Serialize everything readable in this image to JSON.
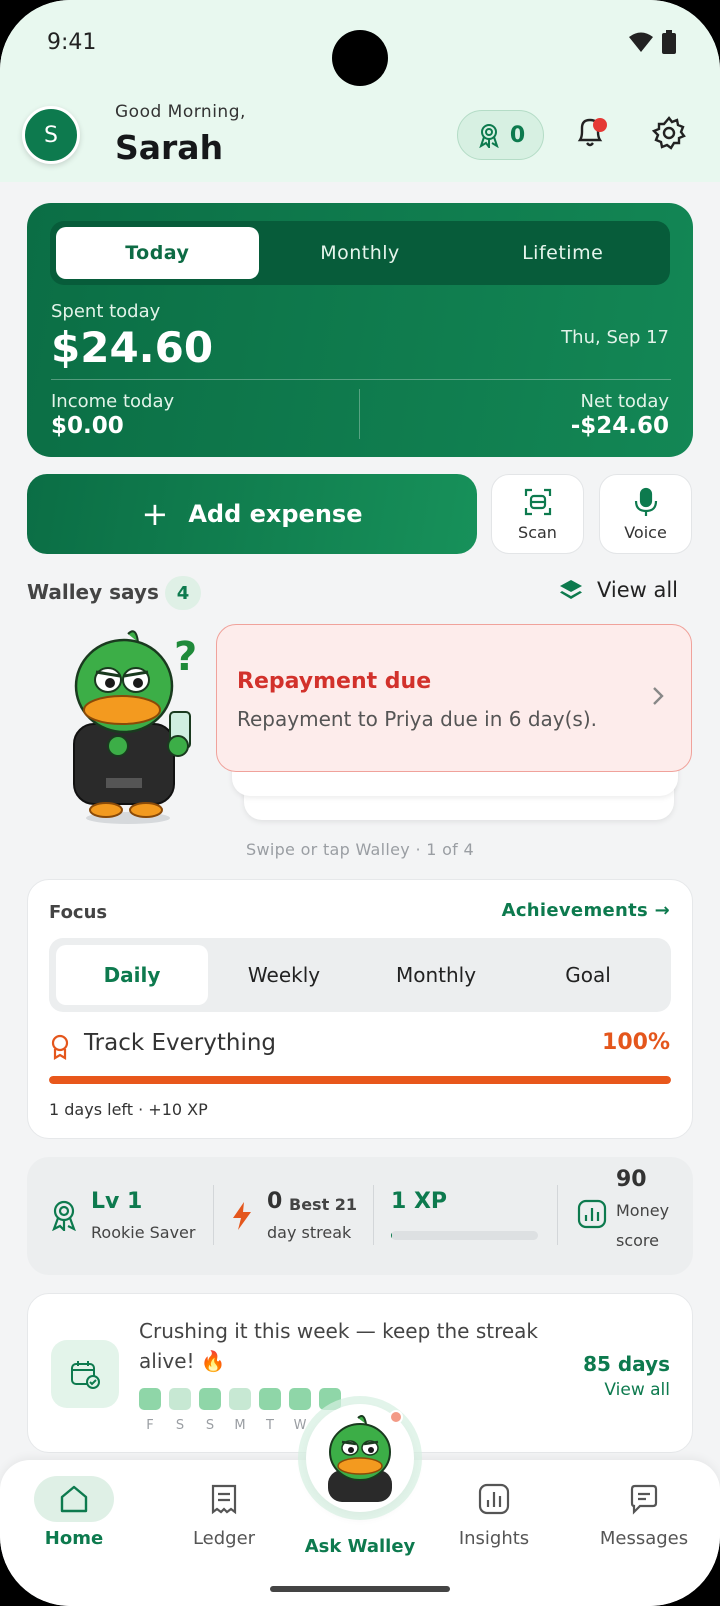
{
  "status_bar": {
    "time": "9:41"
  },
  "header": {
    "avatar_initial": "S",
    "greeting": "Good Morning,",
    "user_name": "Sarah",
    "badge_count": "0"
  },
  "summary": {
    "tabs": [
      "Today",
      "Monthly",
      "Lifetime"
    ],
    "active_tab": "Today",
    "spent_label": "Spent today",
    "spent_value": "$24.60",
    "date": "Thu, Sep 17",
    "income_label": "Income today",
    "income_value": "$0.00",
    "net_label": "Net today",
    "net_value": "-$24.60"
  },
  "actions": {
    "add_expense": "Add expense",
    "scan": "Scan",
    "voice": "Voice"
  },
  "walley": {
    "title": "Walley says",
    "count": "4",
    "view_all": "View all",
    "card_title": "Repayment due",
    "card_body": "Repayment to Priya due in 6 day(s).",
    "hint": "Swipe or tap Walley · 1 of 4"
  },
  "focus": {
    "title": "Focus",
    "achievements_link": "Achievements →",
    "tabs": [
      "Daily",
      "Weekly",
      "Monthly",
      "Goal"
    ],
    "active_tab": "Daily",
    "goal_name": "Track Everything",
    "goal_percent": "100%",
    "goal_progress": 1.0,
    "meta": "1 days left · +10 XP"
  },
  "level": {
    "level": "Lv 1",
    "level_name": "Rookie Saver",
    "streak_value": "0",
    "streak_best": "Best 21",
    "streak_label": "day streak",
    "xp": "1 XP",
    "xp_progress": 0.01,
    "money_score": "90",
    "money_score_label_1": "Money",
    "money_score_label_2": "score"
  },
  "streak_card": {
    "message": "Crushing it this week — keep the streak alive! 🔥",
    "days": "85 days",
    "view_all": "View all",
    "day_labels": [
      "F",
      "S",
      "S",
      "M",
      "T",
      "W",
      "T"
    ],
    "day_levels": [
      "high",
      "low",
      "high",
      "low",
      "high",
      "high",
      "high"
    ]
  },
  "nav": {
    "home": "Home",
    "ledger": "Ledger",
    "ask_walley": "Ask Walley",
    "insights": "Insights",
    "messages": "Messages",
    "active": "Home"
  },
  "colors": {
    "brand_green": "#0d7a4e",
    "alert_red": "#d2312b",
    "goal_orange": "#e8571b"
  }
}
